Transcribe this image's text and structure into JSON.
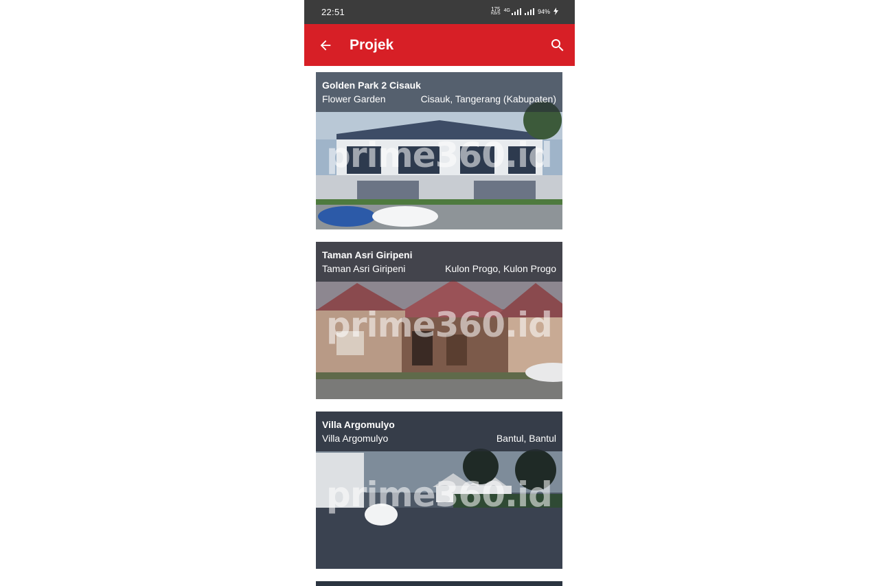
{
  "status_bar": {
    "time": "22:51",
    "net_speed_value": "175",
    "net_speed_unit": "KB/S",
    "network_label": "4G",
    "battery": "94%",
    "icons": [
      "signal-icon",
      "signal-icon",
      "charging-icon"
    ]
  },
  "app_bar": {
    "title": "Projek",
    "back_icon": "arrow-back-icon",
    "search_icon": "search-icon",
    "color": "#d71f26"
  },
  "projects": [
    {
      "title": "Golden Park 2  Cisauk",
      "subtitle": "Flower Garden",
      "location": "Cisauk, Tangerang (Kabupaten)",
      "watermark": "prime360.id"
    },
    {
      "title": "Taman Asri Giripeni",
      "subtitle": "Taman Asri Giripeni",
      "location": "Kulon Progo, Kulon Progo",
      "watermark": "prime360.id"
    },
    {
      "title": "Villa Argomulyo",
      "subtitle": "Villa Argomulyo",
      "location": "Bantul, Bantul",
      "watermark": "prime360.id"
    }
  ]
}
